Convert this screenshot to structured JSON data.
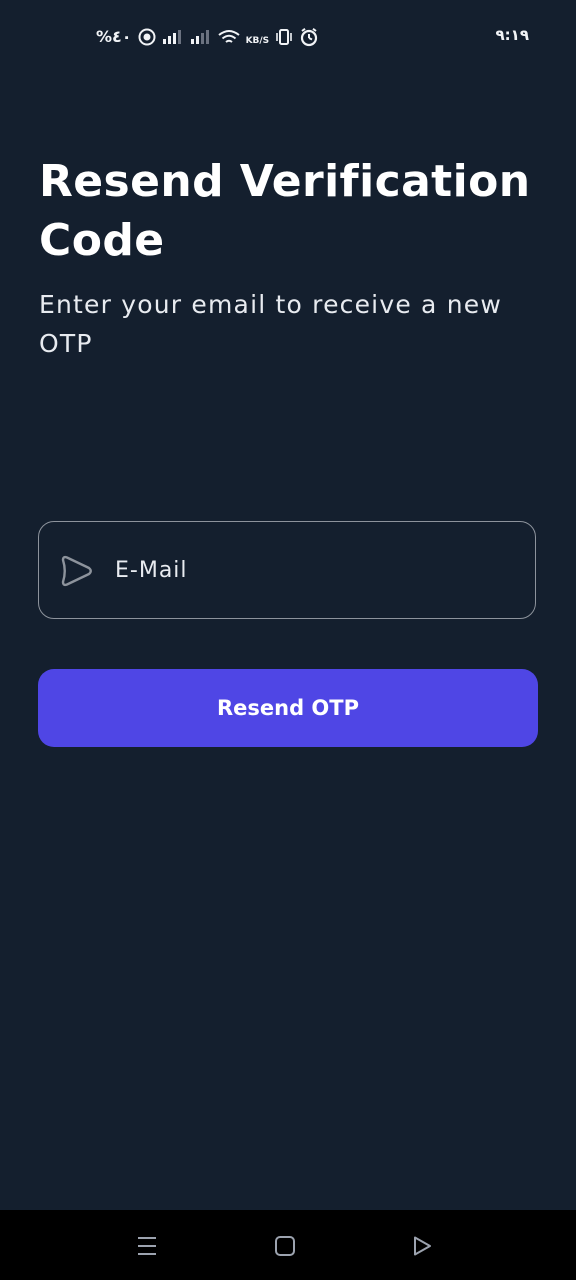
{
  "status_bar": {
    "battery_text": "%٤٠",
    "data_speed_unit": "KB/S",
    "time": "٩:١٩",
    "icons": [
      "battery-saver-icon",
      "signal-icon",
      "signal-icon",
      "wifi-icon",
      "vibrate-icon",
      "alarm-icon"
    ]
  },
  "header": {
    "title": "Resend Verification Code",
    "subtitle": "Enter your email to receive a new OTP"
  },
  "form": {
    "email_placeholder": "E-Mail",
    "email_value": "",
    "email_icon": "play-arrow-icon",
    "submit_label": "Resend OTP"
  },
  "nav_bar": {
    "items": [
      "menu-icon",
      "home-icon",
      "back-icon"
    ]
  },
  "colors": {
    "background": "#141f2e",
    "accent": "#4f46e5",
    "input_border": "#8d939c",
    "nav_bar": "#000000"
  }
}
